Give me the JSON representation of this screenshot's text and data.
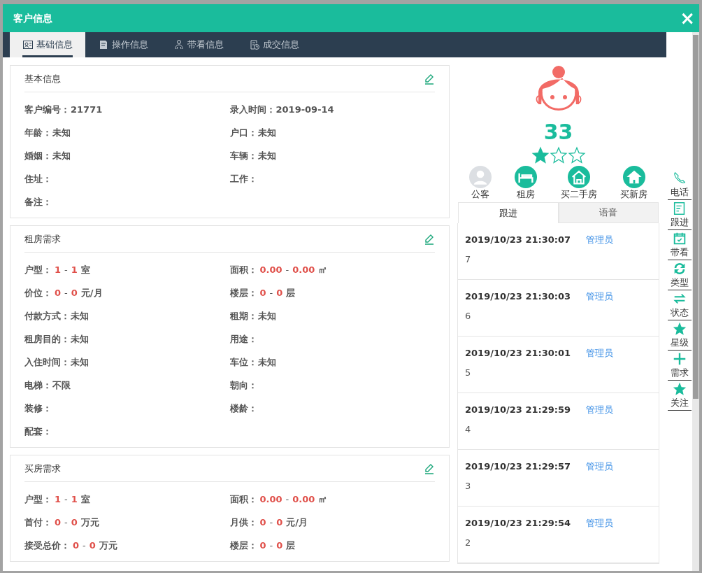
{
  "window": {
    "title": "客户信息",
    "close": "×"
  },
  "tabs": [
    {
      "label": "基础信息",
      "selected": true
    },
    {
      "label": "操作信息",
      "selected": false
    },
    {
      "label": "带看信息",
      "selected": false
    },
    {
      "label": "成交信息",
      "selected": false
    }
  ],
  "sections": [
    {
      "title": "基本信息",
      "fields": [
        {
          "label": "客户编号：",
          "value": "21771"
        },
        {
          "label": "录入时间：",
          "value": "2019-09-14"
        },
        {
          "label": "年龄：",
          "value": "未知"
        },
        {
          "label": "户口：",
          "value": "未知"
        },
        {
          "label": "婚姻：",
          "value": "未知"
        },
        {
          "label": "车辆：",
          "value": "未知"
        },
        {
          "label": "住址："
        },
        {
          "label": "工作："
        },
        {
          "label": "备注："
        }
      ]
    },
    {
      "title": "租房需求",
      "fields": [
        {
          "label": "户型：",
          "min": "1",
          "sep": "-",
          "max": "1",
          "unit": "室"
        },
        {
          "label": "面积：",
          "min": "0.00",
          "sep": "-",
          "max": "0.00",
          "unit": "㎡"
        },
        {
          "label": "价位：",
          "min": "0",
          "sep": "-",
          "max": "0",
          "unit": "元/月"
        },
        {
          "label": "楼层：",
          "min": "0",
          "sep": "-",
          "max": "0",
          "unit": "层"
        },
        {
          "label": "付款方式：",
          "value": "未知"
        },
        {
          "label": "租期：",
          "value": "未知"
        },
        {
          "label": "租房目的：",
          "value": "未知"
        },
        {
          "label": "用途："
        },
        {
          "label": "入住时间：",
          "value": "未知"
        },
        {
          "label": "车位：",
          "value": "未知"
        },
        {
          "label": "电梯：",
          "value": "不限"
        },
        {
          "label": "朝向："
        },
        {
          "label": "装修："
        },
        {
          "label": "楼龄："
        },
        {
          "label": "配套："
        }
      ]
    },
    {
      "title": "买房需求",
      "fields": [
        {
          "label": "户型：",
          "min": "1",
          "sep": "-",
          "max": "1",
          "unit": "室"
        },
        {
          "label": "面积：",
          "min": "0.00",
          "sep": "-",
          "max": "0.00",
          "unit": "㎡"
        },
        {
          "label": "首付：",
          "min": "0",
          "sep": "-",
          "max": "0",
          "unit": "万元"
        },
        {
          "label": "月供：",
          "min": "0",
          "sep": "-",
          "max": "0",
          "unit": "元/月"
        },
        {
          "label": "接受总价：",
          "min": "0",
          "sep": "-",
          "max": "0",
          "unit": "万元"
        },
        {
          "label": "楼层：",
          "min": "0",
          "sep": "-",
          "max": "0",
          "unit": "层"
        }
      ]
    }
  ],
  "profile": {
    "score": "33",
    "stars": 1,
    "categories": [
      {
        "label": "公客",
        "active": false
      },
      {
        "label": "租房",
        "active": true
      },
      {
        "label": "买二手房",
        "active": true
      },
      {
        "label": "买新房",
        "active": true
      }
    ]
  },
  "followup_tabs": [
    {
      "label": "跟进",
      "selected": true
    },
    {
      "label": "语音",
      "selected": false
    }
  ],
  "followups": [
    {
      "time": "2019/10/23 21:30:07",
      "user": "管理员",
      "note": "7"
    },
    {
      "time": "2019/10/23 21:30:03",
      "user": "管理员",
      "note": "6"
    },
    {
      "time": "2019/10/23 21:30:01",
      "user": "管理员",
      "note": "5"
    },
    {
      "time": "2019/10/23 21:29:59",
      "user": "管理员",
      "note": "4"
    },
    {
      "time": "2019/10/23 21:29:57",
      "user": "管理员",
      "note": "3"
    },
    {
      "time": "2019/10/23 21:29:54",
      "user": "管理员",
      "note": "2"
    }
  ],
  "actions": [
    {
      "label": "电话"
    },
    {
      "label": "跟进"
    },
    {
      "label": "带看"
    },
    {
      "label": "类型"
    },
    {
      "label": "状态"
    },
    {
      "label": "星级"
    },
    {
      "label": "需求"
    },
    {
      "label": "关注"
    }
  ]
}
